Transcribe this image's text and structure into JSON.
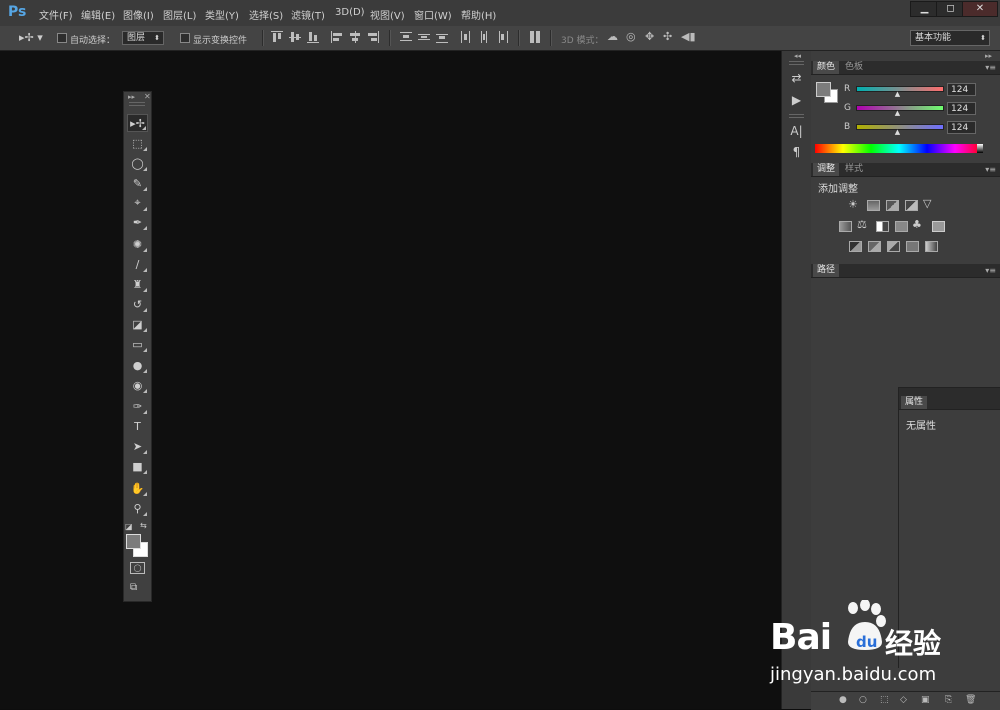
{
  "app": {
    "logo": "Ps"
  },
  "menu": [
    "文件(F)",
    "编辑(E)",
    "图像(I)",
    "图层(L)",
    "类型(Y)",
    "选择(S)",
    "滤镜(T)",
    "3D(D)",
    "视图(V)",
    "窗口(W)",
    "帮助(H)"
  ],
  "window_controls": {
    "minimize": "▁",
    "maximize": "◻",
    "close": "✕"
  },
  "options": {
    "auto_select_label": "自动选择：",
    "auto_select_value": "图层",
    "show_transform_label": "显示变换控件",
    "mode_3d_label": "3D 模式：",
    "workspace": "基本功能"
  },
  "colors": {
    "fg": "#7c7c7c",
    "bg": "#ffffff",
    "accent": "#56a6e4"
  },
  "tools": [
    {
      "name": "move-tool-icon",
      "glyph": "▸✢"
    },
    {
      "name": "marquee-tool-icon",
      "glyph": "⬚"
    },
    {
      "name": "lasso-tool-icon",
      "glyph": "◯"
    },
    {
      "name": "quick-selection-tool-icon",
      "glyph": "✎"
    },
    {
      "name": "crop-tool-icon",
      "glyph": "⌖"
    },
    {
      "name": "eyedropper-tool-icon",
      "glyph": "✒"
    },
    {
      "name": "healing-brush-tool-icon",
      "glyph": "✺"
    },
    {
      "name": "brush-tool-icon",
      "glyph": "∕"
    },
    {
      "name": "clone-stamp-tool-icon",
      "glyph": "♜"
    },
    {
      "name": "history-brush-tool-icon",
      "glyph": "↺"
    },
    {
      "name": "eraser-tool-icon",
      "glyph": "◪"
    },
    {
      "name": "gradient-tool-icon",
      "glyph": "▭"
    },
    {
      "name": "blur-tool-icon",
      "glyph": "●"
    },
    {
      "name": "dodge-tool-icon",
      "glyph": "◉"
    },
    {
      "name": "pen-tool-icon",
      "glyph": "✑"
    },
    {
      "name": "type-tool-icon",
      "glyph": "T"
    },
    {
      "name": "path-selection-tool-icon",
      "glyph": "➤"
    },
    {
      "name": "shape-tool-icon",
      "glyph": "■"
    },
    {
      "name": "hand-tool-icon",
      "glyph": "✋"
    },
    {
      "name": "zoom-tool-icon",
      "glyph": "⚲"
    }
  ],
  "color_panel": {
    "tabs": [
      "颜色",
      "色板"
    ],
    "channels": [
      {
        "label": "R",
        "value": "124",
        "gradient": "linear-gradient(90deg,#00b0b0,#ff6e6e)"
      },
      {
        "label": "G",
        "value": "124",
        "gradient": "linear-gradient(90deg,#b000b0,#6eff6e)"
      },
      {
        "label": "B",
        "value": "124",
        "gradient": "linear-gradient(90deg,#b0b000,#6e6eff)"
      }
    ],
    "level": 0.486
  },
  "adjust_panel": {
    "tabs": [
      "调整",
      "样式"
    ],
    "title": "添加调整"
  },
  "paths_panel": {
    "tabs": [
      "路径"
    ]
  },
  "properties_panel": {
    "tabs": [
      "属性"
    ],
    "text": "无属性"
  },
  "watermark": {
    "brand": "Bai",
    "brand2": "经验",
    "url": "jingyan.baidu.com"
  }
}
